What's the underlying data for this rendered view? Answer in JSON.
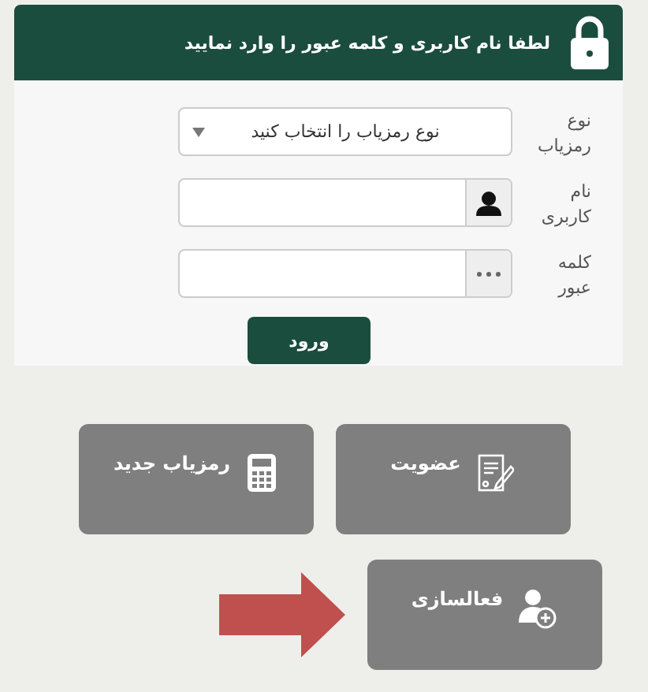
{
  "header": {
    "title": "لطفا نام کاربری و کلمه عبور را وارد نمایید"
  },
  "form": {
    "fields": [
      {
        "kind": "select",
        "label": "نوع رمزیاب",
        "placeholder": "نوع رمزیاب را انتخاب کنید"
      },
      {
        "kind": "user",
        "label": "نام کاربری"
      },
      {
        "kind": "password",
        "label": "کلمه عبور"
      }
    ],
    "submit": "ورود"
  },
  "tiles": [
    {
      "kind": "register",
      "label": "عضویت"
    },
    {
      "kind": "token",
      "label": "رمزیاب جدید"
    },
    {
      "kind": "activate",
      "label": "فعالسازی"
    }
  ]
}
